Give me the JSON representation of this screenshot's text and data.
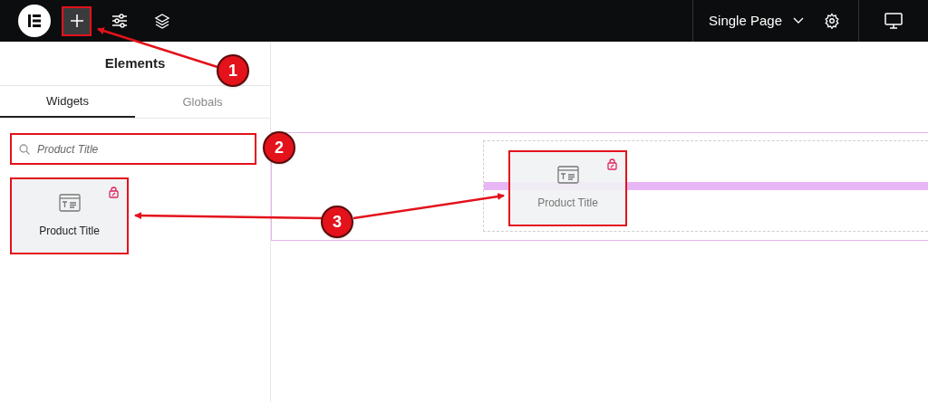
{
  "top_bar": {
    "page_selector": "Single Page"
  },
  "panel": {
    "title": "Elements",
    "tabs": [
      {
        "label": "Widgets",
        "selected": true
      },
      {
        "label": "Globals",
        "selected": false
      }
    ],
    "search": {
      "value": "Product Title"
    },
    "widgets": [
      {
        "label": "Product Title",
        "pro": true
      }
    ]
  },
  "canvas": {
    "dragged_widget": {
      "label": "Product Title",
      "pro": true
    }
  },
  "callouts": [
    "1",
    "2",
    "3"
  ]
}
